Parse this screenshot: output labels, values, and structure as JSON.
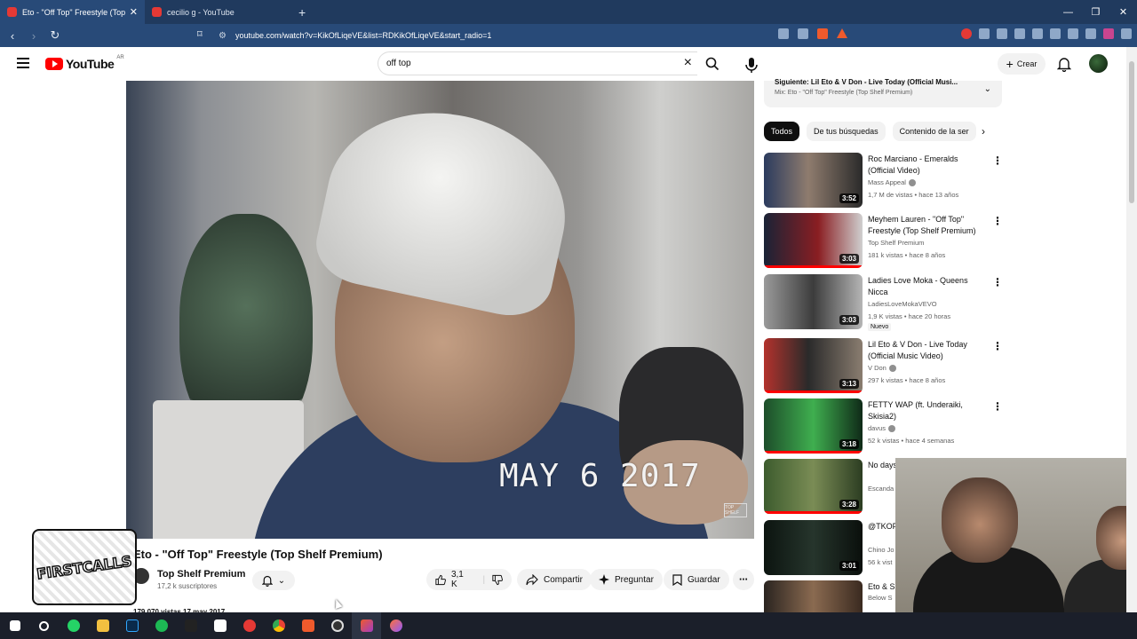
{
  "browser": {
    "tabs": [
      {
        "title": "Eto - \"Off Top\" Freestyle (Top",
        "active": true
      },
      {
        "title": "cecilio g - YouTube",
        "active": false
      }
    ],
    "new_tab": "+",
    "url": "youtube.com/watch?v=KikOfLiqeVE&list=RDKikOfLiqeVE&start_radio=1",
    "window_controls": [
      "—",
      "❐",
      "✕"
    ]
  },
  "youtube": {
    "logo_text": "YouTube",
    "country_code": "AR",
    "search_value": "off top",
    "create_label": "Crear",
    "video": {
      "overlay_date": "MAY 6 2017",
      "title": "Eto - \"Off Top\" Freestyle (Top Shelf Premium)",
      "channel": "Top Shelf Premium",
      "subscribers": "17,2 k suscriptores",
      "likes": "3,1 K",
      "share_label": "Compartir",
      "ask_label": "Preguntar",
      "save_label": "Guardar",
      "views_line": "179.070 vistas  17 may 2017"
    },
    "up_next": {
      "line1": "Siguiente: Lil Eto & V Don - Live Today (Official Musi...",
      "line2": "Mix: Eto - \"Off Top\" Freestyle (Top Shelf Premium)"
    },
    "chips": [
      "Todos",
      "De tus búsquedas",
      "Contenido de la ser"
    ],
    "recommendations": [
      {
        "title": "Roc Marciano - Emeralds (Official Video)",
        "channel": "Mass Appeal",
        "verified": true,
        "meta": "1,7 M de vistas • hace 13 años",
        "duration": "3:52",
        "badge": ""
      },
      {
        "title": "Meyhem Lauren - \"Off Top\" Freestyle (Top Shelf Premium)",
        "channel": "Top Shelf Premium",
        "verified": false,
        "meta": "181 k vistas • hace 8 años",
        "duration": "3:03",
        "badge": ""
      },
      {
        "title": "Ladies Love Moka - Queens Nicca",
        "channel": "LadiesLoveMokaVEVO",
        "verified": false,
        "meta": "1,9 K vistas • hace 20 horas",
        "duration": "3:03",
        "badge": "Nuevo"
      },
      {
        "title": "Lil Eto & V Don - Live Today (Official Music Video)",
        "channel": "V Don",
        "verified": true,
        "meta": "297 k vistas • hace 8 años",
        "duration": "3:13",
        "badge": ""
      },
      {
        "title": "FETTY WAP (ft. Underaiki, Skisia2)",
        "channel": "davus",
        "verified": true,
        "meta": "52 k vistas • hace 4 semanas",
        "duration": "3:18",
        "badge": ""
      },
      {
        "title": "No days Sanche",
        "channel": "Escanda",
        "verified": false,
        "meta": "",
        "duration": "3:28",
        "badge": ""
      },
      {
        "title": "@TKOF LIFE",
        "channel": "Chino Jo",
        "verified": false,
        "meta": "56 k vist",
        "duration": "3:01",
        "badge": ""
      },
      {
        "title": "Eto & S",
        "channel": "Below S",
        "verified": false,
        "meta": "",
        "duration": "",
        "badge": ""
      }
    ],
    "sticker_text": "FIRSTCALLS"
  },
  "colors": {
    "tab_bar": "#203a5e",
    "address_bar": "#284a78",
    "brand_red": "#ff0000",
    "taskbar": "#1b1f2a"
  },
  "taskbar_icons": [
    "windows-icon",
    "search-icon",
    "whatsapp-icon",
    "file-explorer-icon",
    "photoshop-icon",
    "spotify-icon",
    "app-icon",
    "capcut-icon",
    "record-icon",
    "chrome-icon",
    "brave-icon",
    "obs-icon",
    "edge-icon",
    "firefox-icon"
  ]
}
